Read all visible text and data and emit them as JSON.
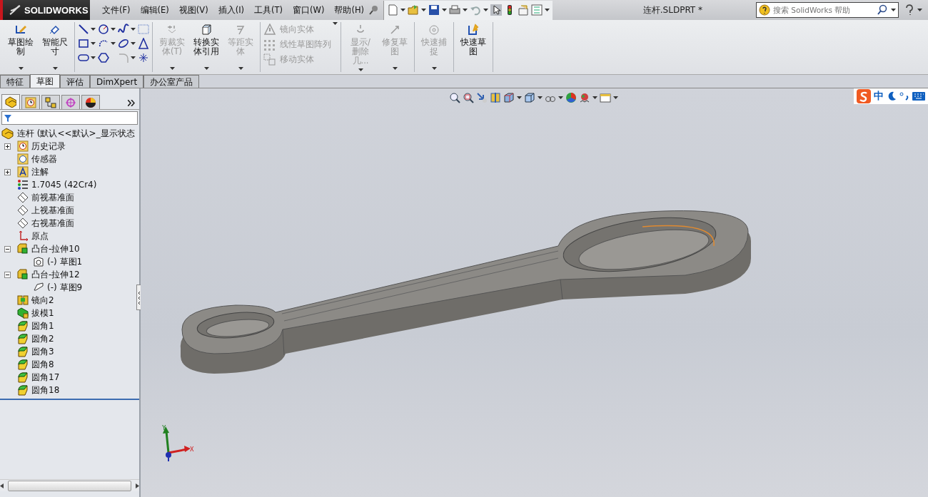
{
  "title_bar": {
    "logo": "SOLIDWORKS",
    "menus": [
      "文件(F)",
      "编辑(E)",
      "视图(V)",
      "插入(I)",
      "工具(T)",
      "窗口(W)",
      "帮助(H)"
    ],
    "document_title": "连杆.SLDPRT *",
    "search": {
      "placeholder": "搜索 SolidWorks 帮助"
    }
  },
  "ribbon": {
    "groups": [
      {
        "kind": "buttons",
        "tools": [
          {
            "label": "草图绘制",
            "disabled": false
          },
          {
            "label": "智能尺寸",
            "disabled": false
          }
        ]
      },
      {
        "kind": "sketch_grid"
      },
      {
        "kind": "buttons",
        "tools": [
          {
            "label": "剪裁实体(T)",
            "disabled": true
          },
          {
            "label": "转换实体引用",
            "disabled": false
          },
          {
            "label": "等距实体",
            "disabled": true
          }
        ]
      },
      {
        "kind": "list",
        "tools": [
          {
            "label": "镜向实体",
            "disabled": true
          },
          {
            "label": "线性草图阵列",
            "disabled": true
          },
          {
            "label": "移动实体",
            "disabled": true
          }
        ]
      },
      {
        "kind": "buttons",
        "tools": [
          {
            "label": "显示/删除几...",
            "disabled": true
          },
          {
            "label": "修复草图",
            "disabled": true
          }
        ]
      },
      {
        "kind": "buttons",
        "tools": [
          {
            "label": "快速捕捉",
            "disabled": true
          }
        ]
      },
      {
        "kind": "buttons",
        "tools": [
          {
            "label": "快速草图",
            "disabled": false
          }
        ]
      }
    ]
  },
  "command_tabs": [
    {
      "label": "特征",
      "selected": false
    },
    {
      "label": "草图",
      "selected": true
    },
    {
      "label": "评估",
      "selected": false
    },
    {
      "label": "DimXpert",
      "selected": false
    },
    {
      "label": "办公室产品",
      "selected": false
    }
  ],
  "feature_manager": {
    "panel_tabs": [
      {
        "selected": true
      },
      {
        "selected": false
      },
      {
        "selected": false
      },
      {
        "selected": false
      },
      {
        "selected": false
      }
    ],
    "root": "连杆  (默认<<默认>_显示状态",
    "items": [
      {
        "label": "历史记录",
        "kind": "history",
        "expanded": false
      },
      {
        "label": "传感器",
        "kind": "sensor"
      },
      {
        "label": "注解",
        "kind": "annotation",
        "expanded": false
      },
      {
        "label": "1.7045 (42Cr4)",
        "kind": "material"
      },
      {
        "label": "前视基准面",
        "kind": "plane"
      },
      {
        "label": "上视基准面",
        "kind": "plane"
      },
      {
        "label": "右视基准面",
        "kind": "plane"
      },
      {
        "label": "原点",
        "kind": "origin"
      },
      {
        "label": "凸台-拉伸10",
        "kind": "extrude",
        "expanded": true,
        "children": [
          {
            "label": "(-) 草图1",
            "kind": "sketch"
          }
        ]
      },
      {
        "label": "凸台-拉伸12",
        "kind": "extrude",
        "expanded": true,
        "children": [
          {
            "label": "(-) 草图9",
            "kind": "sketch2"
          }
        ]
      },
      {
        "label": "镜向2",
        "kind": "mirror"
      },
      {
        "label": "拔模1",
        "kind": "draft"
      },
      {
        "label": "圆角1",
        "kind": "fillet"
      },
      {
        "label": "圆角2",
        "kind": "fillet"
      },
      {
        "label": "圆角3",
        "kind": "fillet"
      },
      {
        "label": "圆角8",
        "kind": "fillet"
      },
      {
        "label": "圆角17",
        "kind": "fillet"
      },
      {
        "label": "圆角18",
        "kind": "fillet"
      }
    ]
  },
  "input_method": {
    "mode": "中"
  },
  "viewport": {
    "axes": {
      "x": "X",
      "y": "Y"
    }
  }
}
